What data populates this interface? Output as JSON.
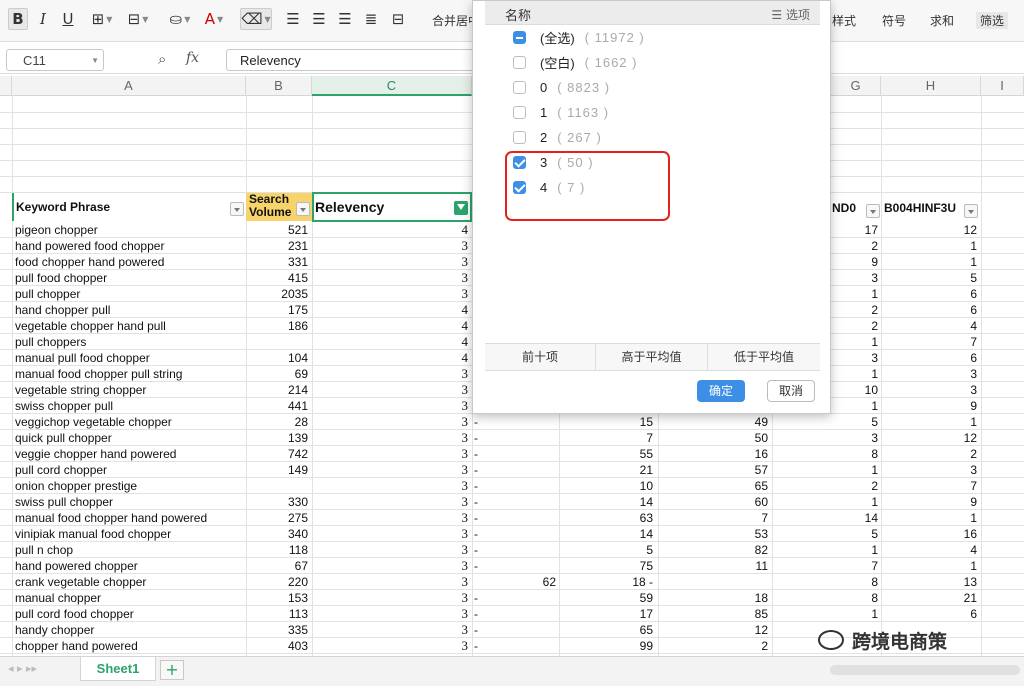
{
  "toolbar": {
    "merge_label": "合并居中",
    "style_label": "样式",
    "symbol_label": "符号",
    "sum_label": "求和",
    "filter_label": "筛选"
  },
  "formula_bar": {
    "cell_ref": "C11",
    "fx": "fx",
    "value": "Relevency"
  },
  "columns": [
    "A",
    "B",
    "C",
    "D",
    "E",
    "F",
    "G",
    "H",
    "I"
  ],
  "header_row": {
    "keyword": "Keyword Phrase",
    "search_volume_1": "Search",
    "search_volume_2": "Volume",
    "relevency": "Relevency",
    "g_header": "ND0",
    "h_header": "B004HINF3U"
  },
  "rows": [
    {
      "kw": "pigeon chopper",
      "sv": "521",
      "rel": "4",
      "d": "",
      "e": "",
      "f": "",
      "g": "17",
      "h": "12"
    },
    {
      "kw": "hand powered food chopper",
      "sv": "231",
      "rel": "3",
      "d": "",
      "e": "",
      "f": "",
      "g": "2",
      "h": "1"
    },
    {
      "kw": "food chopper hand powered",
      "sv": "331",
      "rel": "3",
      "d": "",
      "e": "",
      "f": "",
      "g": "9",
      "h": "1"
    },
    {
      "kw": "pull food chopper",
      "sv": "415",
      "rel": "3",
      "d": "",
      "e": "",
      "f": "",
      "g": "3",
      "h": "5"
    },
    {
      "kw": "pull chopper",
      "sv": "2035",
      "rel": "3",
      "d": "",
      "e": "",
      "f": "",
      "g": "1",
      "h": "6"
    },
    {
      "kw": "hand chopper pull",
      "sv": "175",
      "rel": "4",
      "d": "",
      "e": "",
      "f": "",
      "g": "2",
      "h": "6"
    },
    {
      "kw": "vegetable chopper hand pull",
      "sv": "186",
      "rel": "4",
      "d": "",
      "e": "",
      "f": "",
      "g": "2",
      "h": "4"
    },
    {
      "kw": "pull choppers",
      "sv": "",
      "rel": "4",
      "d": "",
      "e": "",
      "f": "",
      "g": "1",
      "h": "7"
    },
    {
      "kw": "manual pull food chopper",
      "sv": "104",
      "rel": "4",
      "d": "",
      "e": "",
      "f": "",
      "g": "3",
      "h": "6"
    },
    {
      "kw": "manual food chopper pull string",
      "sv": "69",
      "rel": "3",
      "d": "",
      "e": "",
      "f": "",
      "g": "1",
      "h": "3"
    },
    {
      "kw": "vegetable string chopper",
      "sv": "214",
      "rel": "3",
      "d": "",
      "e": "",
      "f": "",
      "g": "10",
      "h": "3"
    },
    {
      "kw": "swiss chopper pull",
      "sv": "441",
      "rel": "3",
      "d": "",
      "e": "",
      "f": "",
      "g": "1",
      "h": "9"
    },
    {
      "kw": "veggichop vegetable chopper",
      "sv": "28",
      "rel": "3",
      "d": "-",
      "e": "15",
      "f": "49",
      "g": "5",
      "h": "1"
    },
    {
      "kw": "quick pull chopper",
      "sv": "139",
      "rel": "3",
      "d": "-",
      "e": "7",
      "f": "50",
      "g": "3",
      "h": "12"
    },
    {
      "kw": "veggie chopper hand powered",
      "sv": "742",
      "rel": "3",
      "d": "-",
      "e": "55",
      "f": "16",
      "g": "8",
      "h": "2"
    },
    {
      "kw": "pull cord chopper",
      "sv": "149",
      "rel": "3",
      "d": "-",
      "e": "21",
      "f": "57",
      "g": "1",
      "h": "3"
    },
    {
      "kw": "onion chopper prestige",
      "sv": "",
      "rel": "3",
      "d": "-",
      "e": "10",
      "f": "65",
      "g": "2",
      "h": "7"
    },
    {
      "kw": "swiss pull chopper",
      "sv": "330",
      "rel": "3",
      "d": "-",
      "e": "14",
      "f": "60",
      "g": "1",
      "h": "9"
    },
    {
      "kw": "manual food chopper hand powered",
      "sv": "275",
      "rel": "3",
      "d": "-",
      "e": "63",
      "f": "7",
      "g": "14",
      "h": "1"
    },
    {
      "kw": "vinipiak manual food chopper",
      "sv": "340",
      "rel": "3",
      "d": "-",
      "e": "14",
      "f": "53",
      "g": "5",
      "h": "16"
    },
    {
      "kw": "pull n chop",
      "sv": "118",
      "rel": "3",
      "d": "-",
      "e": "5",
      "f": "82",
      "g": "1",
      "h": "4"
    },
    {
      "kw": "hand powered chopper",
      "sv": "67",
      "rel": "3",
      "d": "-",
      "e": "75",
      "f": "11",
      "g": "7",
      "h": "1"
    },
    {
      "kw": "crank vegetable chopper",
      "sv": "220",
      "rel": "3",
      "d": "62",
      "e": "18 -",
      "f": "",
      "g": "8",
      "h": "13"
    },
    {
      "kw": "manual chopper",
      "sv": "153",
      "rel": "3",
      "d": "-",
      "e": "59",
      "f": "18",
      "g": "8",
      "h": "21"
    },
    {
      "kw": "pull cord food chopper",
      "sv": "113",
      "rel": "3",
      "d": "-",
      "e": "17",
      "f": "85",
      "g": "1",
      "h": "6"
    },
    {
      "kw": "handy chopper",
      "sv": "335",
      "rel": "3",
      "d": "-",
      "e": "65",
      "f": "12",
      "g": "",
      "h": ""
    },
    {
      "kw": "chopper hand powered",
      "sv": "403",
      "rel": "3",
      "d": "-",
      "e": "99",
      "f": "2",
      "g": "",
      "h": ""
    }
  ],
  "filter_popup": {
    "title": "名称",
    "options_label": "选项",
    "items": [
      {
        "label": "(全选)",
        "count": "( 11972 )",
        "state": "partial"
      },
      {
        "label": "(空白)",
        "count": "( 1662 )",
        "state": "unchecked"
      },
      {
        "label": "0",
        "count": "( 8823 )",
        "state": "unchecked"
      },
      {
        "label": "1",
        "count": "( 1163 )",
        "state": "unchecked"
      },
      {
        "label": "2",
        "count": "( 267 )",
        "state": "unchecked"
      },
      {
        "label": "3",
        "count": "( 50 )",
        "state": "checked"
      },
      {
        "label": "4",
        "count": "( 7 )",
        "state": "checked"
      }
    ],
    "top10": "前十项",
    "above_avg": "高于平均值",
    "below_avg": "低于平均值",
    "ok": "确定",
    "cancel": "取消"
  },
  "sheet_tab": "Sheet1",
  "add_sheet": "+",
  "watermark": "跨境电商策"
}
